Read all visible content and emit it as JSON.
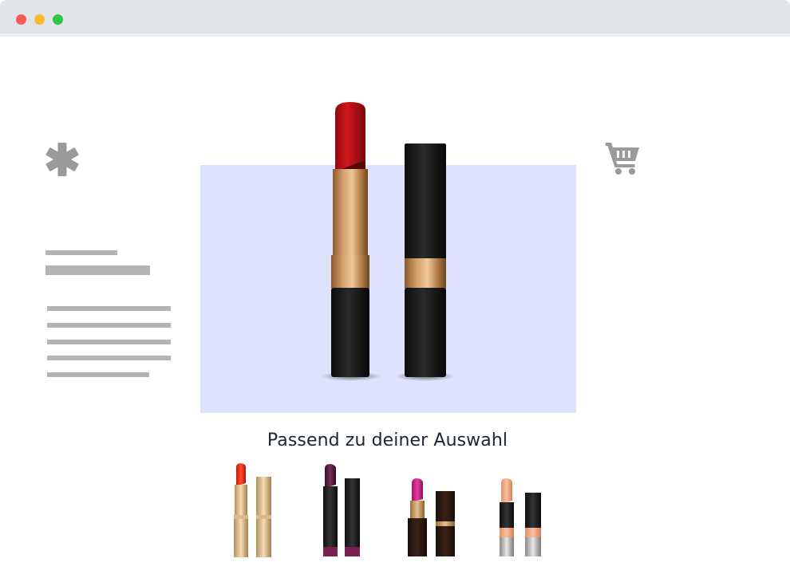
{
  "window": {
    "controls": [
      "close",
      "minimize",
      "maximize"
    ]
  },
  "header": {
    "logo_icon": "asterisk-logo-icon",
    "cart_icon": "shopping-cart-icon"
  },
  "hero": {
    "product_image": "lipstick-red-and-black-case",
    "background_color": "#dfe2fd"
  },
  "recommendations": {
    "title": "Passend zu deiner Auswahl",
    "items": [
      {
        "image": "lipstick-red-gold"
      },
      {
        "image": "lipstick-plum-black"
      },
      {
        "image": "lipstick-pink-brown"
      },
      {
        "image": "lipstick-peach-silver"
      }
    ]
  },
  "colors": {
    "titlebar": "#e1e4e9",
    "skeleton": "#b4b4b4",
    "icon_gray": "#9a9a9a",
    "title_text": "#1c2533"
  }
}
